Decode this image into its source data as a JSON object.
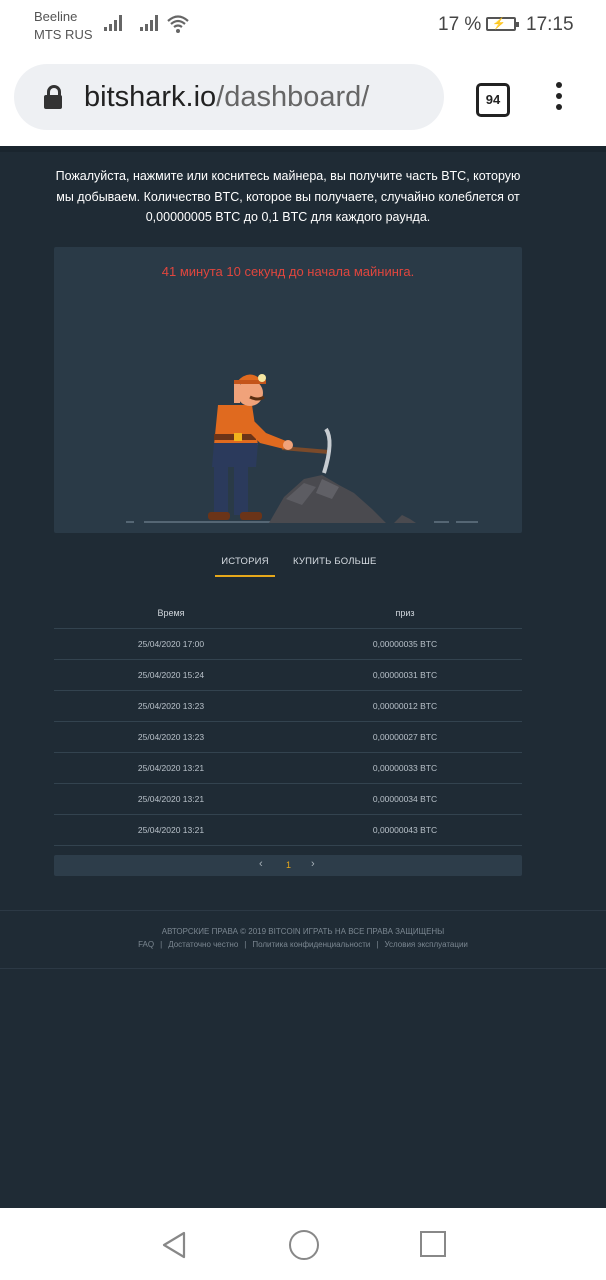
{
  "status_bar": {
    "carrier_line1": "Beeline",
    "carrier_line2": "MTS RUS",
    "battery": "17 %",
    "time": "17:15"
  },
  "browser": {
    "url_host": "bitshark.io",
    "url_path": "/dashboard/",
    "tab_count": "94"
  },
  "mining": {
    "intro": "Пожалуйста, нажмите или коснитесь майнера, вы получите часть BTC, которую мы добываем. Количество BTC, которое вы получаете, случайно колеблется от 0,00000005 BTC до 0,1 BTC для каждого раунда.",
    "countdown": "41 минута 10 секунд до начала майнинга."
  },
  "tabs": [
    {
      "label": "ИСТОРИЯ",
      "active": true
    },
    {
      "label": "КУПИТЬ БОЛЬШЕ",
      "active": false
    }
  ],
  "history": {
    "columns": [
      "Время",
      "приз"
    ],
    "rows": [
      [
        "25/04/2020 17:00",
        "0,00000035 BTC"
      ],
      [
        "25/04/2020 15:24",
        "0,00000031 BTC"
      ],
      [
        "25/04/2020 13:23",
        "0,00000012 BTC"
      ],
      [
        "25/04/2020 13:23",
        "0,00000027 BTC"
      ],
      [
        "25/04/2020 13:21",
        "0,00000033 BTC"
      ],
      [
        "25/04/2020 13:21",
        "0,00000034 BTC"
      ],
      [
        "25/04/2020 13:21",
        "0,00000043 BTC"
      ]
    ]
  },
  "pagination": {
    "prev": "‹",
    "current": "1",
    "next": "›"
  },
  "footer": {
    "copyright": "АВТОРСКИЕ ПРАВА © 2019 BITCOIN ИГРАТЬ НА ВСЕ ПРАВА ЗАЩИЩЕНЫ",
    "links": [
      "FAQ",
      "Достаточно честно",
      "Политика конфиденциальности",
      "Условия эксплуатации"
    ],
    "separator": "|"
  },
  "colors": {
    "page_bg": "#1f2b35",
    "box_bg": "#2a3a47",
    "accent": "#e6a81b",
    "countdown": "#e0463e"
  }
}
